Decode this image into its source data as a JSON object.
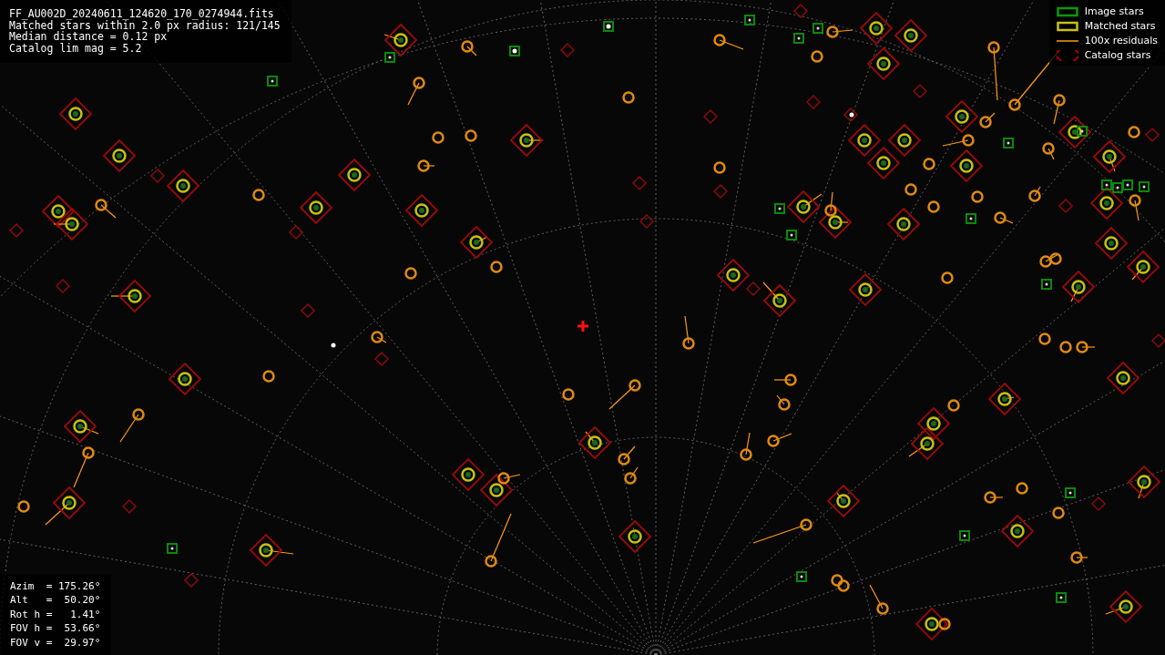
{
  "info_lines": [
    "FF_AU002D_20240611_124620_170_0274944.fits",
    "Matched stars within 2.0 px radius: 121/145",
    "Median distance = 0.12 px",
    "Catalog lim mag = 5.2"
  ],
  "legend": [
    {
      "kind": "image",
      "label": "Image stars"
    },
    {
      "kind": "matched",
      "label": "Matched stars"
    },
    {
      "kind": "residual",
      "label": "100x residuals"
    },
    {
      "kind": "catalog",
      "label": "Catalog stars"
    }
  ],
  "pointing_lines": [
    "Azim  = 175.26°",
    "Alt   =  50.20°",
    "Rot h =   1.41°",
    "FOV h =  53.66°",
    "FOV v =  29.97°"
  ]
}
